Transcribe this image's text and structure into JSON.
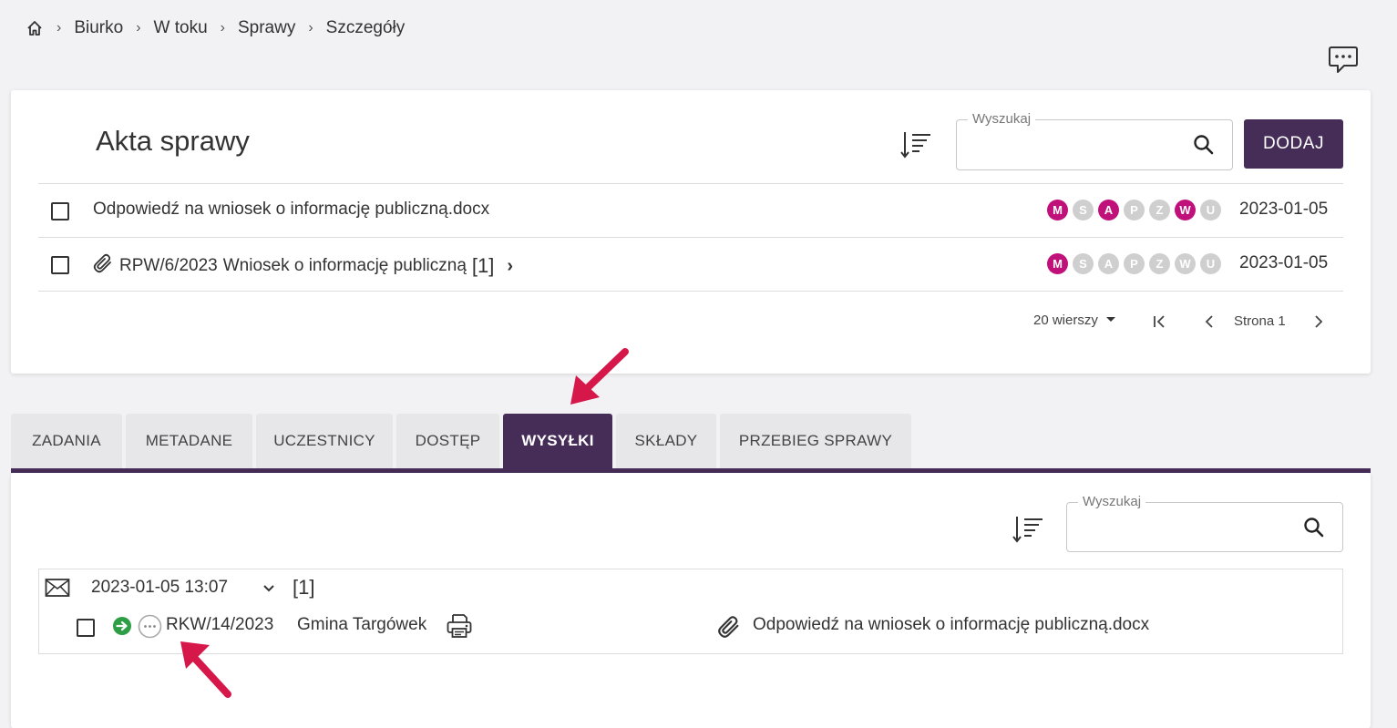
{
  "breadcrumb": {
    "items": [
      "Biurko",
      "W toku",
      "Sprawy",
      "Szczegóły"
    ],
    "separator": "›"
  },
  "section": {
    "title": "Akta sprawy",
    "search": {
      "legend": "Wyszukaj",
      "value": ""
    },
    "add_label": "DODAJ",
    "rows": [
      {
        "text": "Odpowiedź na wniosek o informację publiczną.docx",
        "badges": [
          {
            "letter": "M",
            "active": true
          },
          {
            "letter": "S",
            "active": false
          },
          {
            "letter": "A",
            "active": true
          },
          {
            "letter": "P",
            "active": false
          },
          {
            "letter": "Z",
            "active": false
          },
          {
            "letter": "W",
            "active": true
          },
          {
            "letter": "U",
            "active": false
          }
        ],
        "date": "2023-01-05"
      },
      {
        "number": "RPW/6/2023",
        "text": "Wniosek o informację publiczną",
        "count": "[1]",
        "badges": [
          {
            "letter": "M",
            "active": true
          },
          {
            "letter": "S",
            "active": false
          },
          {
            "letter": "A",
            "active": false
          },
          {
            "letter": "P",
            "active": false
          },
          {
            "letter": "Z",
            "active": false
          },
          {
            "letter": "W",
            "active": false
          },
          {
            "letter": "U",
            "active": false
          }
        ],
        "date": "2023-01-05"
      }
    ],
    "pagination": {
      "rows_label": "20 wierszy",
      "page_label": "Strona 1"
    }
  },
  "tabs": [
    {
      "label": "ZADANIA",
      "active": false
    },
    {
      "label": "METADANE",
      "active": false
    },
    {
      "label": "UCZESTNICY",
      "active": false
    },
    {
      "label": "DOSTĘP",
      "active": false
    },
    {
      "label": "WYSYŁKI",
      "active": true
    },
    {
      "label": "SKŁADY",
      "active": false
    },
    {
      "label": "PRZEBIEG SPRAWY",
      "active": false
    }
  ],
  "shipments": {
    "search": {
      "legend": "Wyszukaj",
      "value": ""
    },
    "group": {
      "datetime": "2023-01-05 13:07",
      "count": "[1]",
      "item": {
        "number": "RKW/14/2023",
        "recipient": "Gmina Targówek",
        "attachment": "Odpowiedź na wniosek o informację publiczną.docx"
      }
    }
  },
  "colors": {
    "accent": "#452d58",
    "badge_active": "#c0117a",
    "badge_inactive": "#cfcfcf",
    "status_green": "#2e9e46",
    "annotation_arrow": "#d6174a"
  }
}
